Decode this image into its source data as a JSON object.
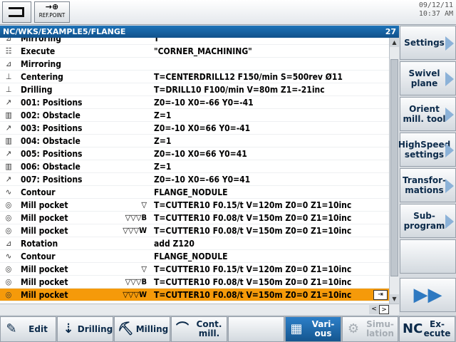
{
  "status": {
    "refpoint_glyph": "→⊕",
    "refpoint_label": "REF.POINT",
    "date": "09/12/11",
    "time": "10:37 AM"
  },
  "program": {
    "path": "NC/WKS/EXAMPLE5/FLANGE",
    "count": "27"
  },
  "rows": [
    {
      "icon": "⊿",
      "name": "Mirroring",
      "marks": "",
      "param": "T"
    },
    {
      "icon": "☷",
      "name": "Execute",
      "marks": "",
      "param": "\"CORNER_MACHINING\""
    },
    {
      "icon": "⊿",
      "name": "Mirroring",
      "marks": "",
      "param": ""
    },
    {
      "icon": "⊥",
      "name": "Centering",
      "marks": "",
      "param": "T=CENTERDRILL12 F150/min S=500rev Ø11"
    },
    {
      "icon": "⊥",
      "name": "Drilling",
      "marks": "",
      "param": "T=DRILL10 F100/min V=80m Z1=-21inc"
    },
    {
      "icon": "↗",
      "name": "001: Positions",
      "marks": "",
      "param": "Z0=-10 X0=-66 Y0=-41"
    },
    {
      "icon": "▥",
      "name": "002: Obstacle",
      "marks": "",
      "param": "Z=1"
    },
    {
      "icon": "↗",
      "name": "003: Positions",
      "marks": "",
      "param": "Z0=-10 X0=66 Y0=-41"
    },
    {
      "icon": "▥",
      "name": "004: Obstacle",
      "marks": "",
      "param": "Z=1"
    },
    {
      "icon": "↗",
      "name": "005: Positions",
      "marks": "",
      "param": "Z0=-10 X0=66 Y0=41"
    },
    {
      "icon": "▥",
      "name": "006: Obstacle",
      "marks": "",
      "param": "Z=1"
    },
    {
      "icon": "↗",
      "name": "007: Positions",
      "marks": "",
      "param": "Z0=-10 X0=-66 Y0=41"
    },
    {
      "icon": "∿",
      "name": "Contour",
      "marks": "",
      "param": "FLANGE_NODULE"
    },
    {
      "icon": "◎",
      "name": "Mill pocket",
      "marks": "▽",
      "param": "T=CUTTER10 F0.15/t V=120m Z0=0 Z1=10inc"
    },
    {
      "icon": "◎",
      "name": "Mill pocket",
      "marks": "▽▽▽B",
      "param": "T=CUTTER10 F0.08/t V=150m Z0=0 Z1=10inc"
    },
    {
      "icon": "◎",
      "name": "Mill pocket",
      "marks": "▽▽▽W",
      "param": "T=CUTTER10 F0.08/t V=150m Z0=0 Z1=10inc"
    },
    {
      "icon": "⊿",
      "name": "Rotation",
      "marks": "",
      "param": "add Z120"
    },
    {
      "icon": "∿",
      "name": "Contour",
      "marks": "",
      "param": "FLANGE_NODULE"
    },
    {
      "icon": "◎",
      "name": "Mill pocket",
      "marks": "▽",
      "param": "T=CUTTER10 F0.15/t V=120m Z0=0 Z1=10inc"
    },
    {
      "icon": "◎",
      "name": "Mill pocket",
      "marks": "▽▽▽B",
      "param": "T=CUTTER10 F0.08/t V=150m Z0=0 Z1=10inc"
    },
    {
      "icon": "◎",
      "name": "Mill pocket",
      "marks": "▽▽▽W",
      "param": "T=CUTTER10 F0.08/t V=150m Z0=0 Z1=10inc",
      "selected": true
    }
  ],
  "vertical_softkeys": [
    "Settings",
    "Swivel plane",
    "Orient mill. tool",
    "HighSpeed settings",
    "Transfor-mations",
    "Sub-program",
    "",
    "▶▶"
  ],
  "horizontal_softkeys": [
    {
      "label": "Edit",
      "icon": "✎",
      "state": "normal"
    },
    {
      "label": "Drilling",
      "icon": "⇣",
      "state": "normal"
    },
    {
      "label": "Milling",
      "icon": "⛏",
      "state": "normal"
    },
    {
      "label": "Cont. mill.",
      "icon": "⌒",
      "state": "normal"
    },
    {
      "label": "",
      "icon": "",
      "state": "normal"
    },
    {
      "label": "Vari-ous",
      "icon": "▦",
      "state": "active"
    },
    {
      "label": "Simu-lation",
      "icon": "⚙",
      "state": "disabled"
    },
    {
      "label": "Ex-ecute",
      "icon": "NC",
      "state": "normal"
    }
  ],
  "colors": {
    "accent": "#1d73b8",
    "selection": "#f59a0a"
  }
}
